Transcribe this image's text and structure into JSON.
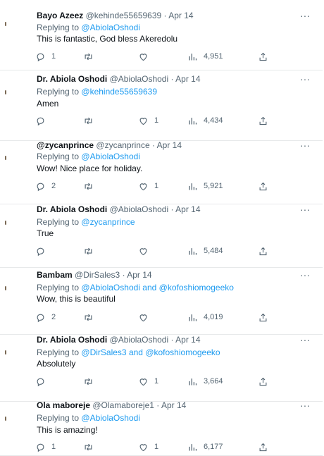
{
  "tweets": [
    {
      "name": "Bayo Azeez",
      "handle": "@kehinde55659639",
      "date": "Apr 14",
      "reply_prefix": "Replying to",
      "mention1": "@AbiolaOshodi",
      "joiner": "",
      "mention2": "",
      "text": "This is fantastic, God bless Akeredolu",
      "replies": "1",
      "retweets": "",
      "likes": "",
      "views": "4,951"
    },
    {
      "name": "Dr. Abiola Oshodi",
      "handle": "@AbiolaOshodi",
      "date": "Apr 14",
      "reply_prefix": "Replying to",
      "mention1": "@kehinde55659639",
      "joiner": "",
      "mention2": "",
      "text": "Amen",
      "replies": "",
      "retweets": "",
      "likes": "1",
      "views": "4,434"
    },
    {
      "name": "@zycanprince",
      "handle": "@zycanprince",
      "date": "Apr 14",
      "reply_prefix": "Replying to",
      "mention1": "@AbiolaOshodi",
      "joiner": "",
      "mention2": "",
      "text": "Wow! Nice place for holiday.",
      "replies": "2",
      "retweets": "",
      "likes": "1",
      "views": "5,921"
    },
    {
      "name": "Dr. Abiola Oshodi",
      "handle": "@AbiolaOshodi",
      "date": "Apr 14",
      "reply_prefix": "Replying to",
      "mention1": "@zycanprince",
      "joiner": "",
      "mention2": "",
      "text": "True",
      "replies": "",
      "retweets": "",
      "likes": "",
      "views": "5,484"
    },
    {
      "name": "Bambam",
      "handle": "@DirSales3",
      "date": "Apr 14",
      "reply_prefix": "Replying to",
      "mention1": "@AbiolaOshodi",
      "joiner": "and",
      "mention2": "@kofoshiomogeeko",
      "text": "Wow, this is beautiful",
      "replies": "2",
      "retweets": "",
      "likes": "",
      "views": "4,019"
    },
    {
      "name": "Dr. Abiola Oshodi",
      "handle": "@AbiolaOshodi",
      "date": "Apr 14",
      "reply_prefix": "Replying to",
      "mention1": "@DirSales3",
      "joiner": "and",
      "mention2": "@kofoshiomogeeko",
      "text": "Absolutely",
      "replies": "",
      "retweets": "",
      "likes": "1",
      "views": "3,664"
    },
    {
      "name": "Ola maboreje",
      "handle": "@Olamaboreje1",
      "date": "Apr 14",
      "reply_prefix": "Replying to",
      "mention1": "@AbiolaOshodi",
      "joiner": "",
      "mention2": "",
      "text": "This is amazing!",
      "replies": "1",
      "retweets": "",
      "likes": "1",
      "views": "6,177"
    }
  ],
  "icons": {
    "reply": "reply-icon",
    "retweet": "retweet-icon",
    "like": "heart-icon",
    "views": "views-icon",
    "share": "share-icon",
    "more": "more-icon"
  },
  "colors": {
    "link": "#1d9bf0",
    "muted": "#536471",
    "text": "#0f1419",
    "divider": "#e7e9ea"
  }
}
